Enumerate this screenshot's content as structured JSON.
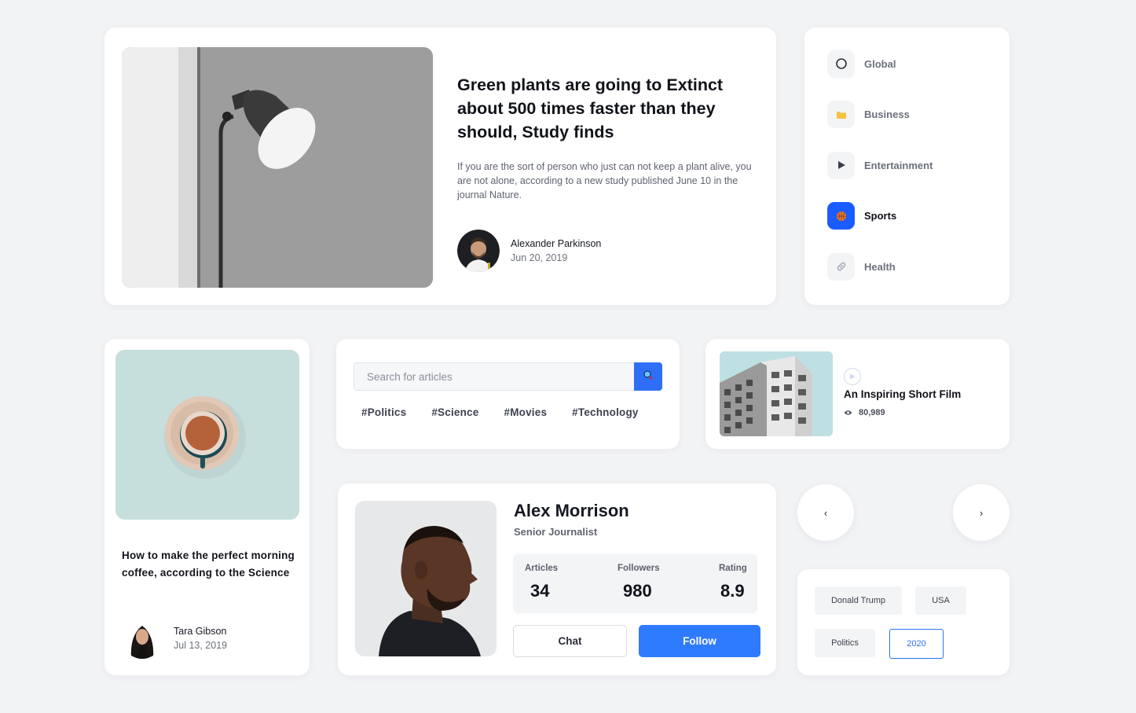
{
  "featured": {
    "title": "Green plants are going to Extinct about 500 times faster than they should, Study finds",
    "excerpt": "If you are the sort of person who just can not keep a plant alive, you are not alone, according to a new study published June 10 in the journal Nature.",
    "author": "Alexander Parkinson",
    "date": "Jun 20, 2019"
  },
  "categories": [
    {
      "label": "Global",
      "icon": "globe-icon",
      "active": false
    },
    {
      "label": "Business",
      "icon": "folder-icon",
      "active": false
    },
    {
      "label": "Entertainment",
      "icon": "play-icon",
      "active": false
    },
    {
      "label": "Sports",
      "icon": "basketball-icon",
      "active": true
    },
    {
      "label": "Health",
      "icon": "pill-icon",
      "active": false
    }
  ],
  "coffee_article": {
    "title": "How to make the perfect morning coffee, according to the Science",
    "author": "Tara Gibson",
    "date": "Jul 13, 2019"
  },
  "search": {
    "placeholder": "Search for articles",
    "tags": [
      "#Politics",
      "#Science",
      "#Movies",
      "#Technology"
    ]
  },
  "video": {
    "title": "An Inspiring Short Film",
    "views": "80,989"
  },
  "profile": {
    "name": "Alex Morrison",
    "role": "Senior Journalist",
    "stats": [
      {
        "label": "Articles",
        "value": "34"
      },
      {
        "label": "Followers",
        "value": "980"
      },
      {
        "label": "Rating",
        "value": "8.9"
      }
    ],
    "chat_label": "Chat",
    "follow_label": "Follow"
  },
  "nav": {
    "prev": "‹",
    "next": "›"
  },
  "tag_cloud": [
    {
      "label": "Donald Trump",
      "selected": false
    },
    {
      "label": "USA",
      "selected": false
    },
    {
      "label": "Politics",
      "selected": false
    },
    {
      "label": "2020",
      "selected": true
    }
  ],
  "colors": {
    "accent": "#2f7bff",
    "active_category": "#1b5cff",
    "background": "#f2f3f5"
  }
}
